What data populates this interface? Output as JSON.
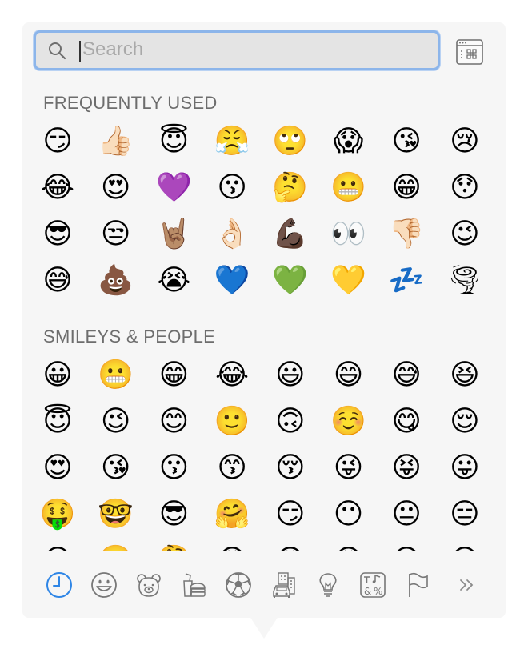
{
  "search": {
    "placeholder": "Search",
    "value": ""
  },
  "sections": [
    {
      "title": "FREQUENTLY USED",
      "emojis": [
        "😏",
        "👍🏻",
        "😇",
        "😤",
        "🙄",
        "😱",
        "😘",
        "😢",
        "😂",
        "😍",
        "💜",
        "😗",
        "🤔",
        "😬",
        "😁",
        "😯",
        "😎",
        "😒",
        "🤘🏽",
        "👌🏻",
        "💪🏿",
        "👀",
        "👎🏻",
        "😉",
        "😅",
        "💩",
        "😭",
        "💙",
        "💚",
        "💛",
        "💤",
        "🌪"
      ]
    },
    {
      "title": "SMILEYS & PEOPLE",
      "emojis": [
        "😀",
        "😬",
        "😁",
        "😂",
        "😃",
        "😄",
        "😅",
        "😆",
        "😇",
        "😉",
        "😊",
        "🙂",
        "🙃",
        "☺️",
        "😋",
        "😌",
        "😍",
        "😘",
        "😗",
        "😙",
        "😚",
        "😜",
        "😝",
        "😛",
        "🤑",
        "🤓",
        "😎",
        "🤗",
        "😏",
        "😶",
        "😐",
        "😑",
        "😒",
        "🙄",
        "🤔",
        "😳",
        "😞",
        "😟",
        "😠",
        "😡"
      ]
    }
  ],
  "tabs": [
    {
      "name": "tab-frequently-used",
      "icon": "clock-icon",
      "active": true
    },
    {
      "name": "tab-smileys-people",
      "icon": "smiley-icon",
      "active": false
    },
    {
      "name": "tab-animals-nature",
      "icon": "bear-icon",
      "active": false
    },
    {
      "name": "tab-food-drink",
      "icon": "burger-icon",
      "active": false
    },
    {
      "name": "tab-activity",
      "icon": "soccer-ball-icon",
      "active": false
    },
    {
      "name": "tab-travel-places",
      "icon": "car-building-icon",
      "active": false
    },
    {
      "name": "tab-objects",
      "icon": "lightbulb-icon",
      "active": false
    },
    {
      "name": "tab-symbols",
      "icon": "symbols-icon",
      "active": false
    },
    {
      "name": "tab-flags",
      "icon": "flag-icon",
      "active": false
    },
    {
      "name": "tab-more",
      "icon": "chevron-double-right-icon",
      "active": false
    }
  ],
  "colors": {
    "accent": "#2f86e6",
    "icon": "#777777",
    "focus_ring": "#8cb5ea"
  }
}
